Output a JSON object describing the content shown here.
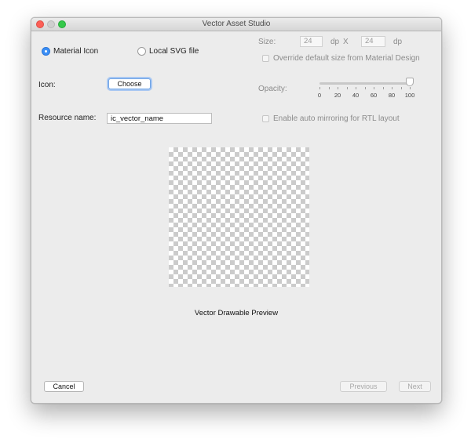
{
  "window": {
    "title": "Vector Asset Studio"
  },
  "source": {
    "material_icon_label": "Material Icon",
    "local_svg_label": "Local SVG file",
    "selected": "Material Icon"
  },
  "icon": {
    "label": "Icon:",
    "choose_label": "Choose"
  },
  "resource": {
    "label": "Resource name:",
    "value": "ic_vector_name"
  },
  "size": {
    "label": "Size:",
    "width": "24",
    "height": "24",
    "unit": "dp",
    "separator": "X",
    "override_label": "Override default size from Material Design",
    "override_checked": false
  },
  "opacity": {
    "label": "Opacity:",
    "value": 100,
    "ticks": [
      "0",
      "20",
      "40",
      "60",
      "80",
      "100"
    ]
  },
  "mirroring": {
    "label": "Enable auto mirroring for RTL layout",
    "checked": false
  },
  "preview": {
    "caption": "Vector Drawable Preview"
  },
  "footer": {
    "cancel_label": "Cancel",
    "previous_label": "Previous",
    "next_label": "Next"
  }
}
